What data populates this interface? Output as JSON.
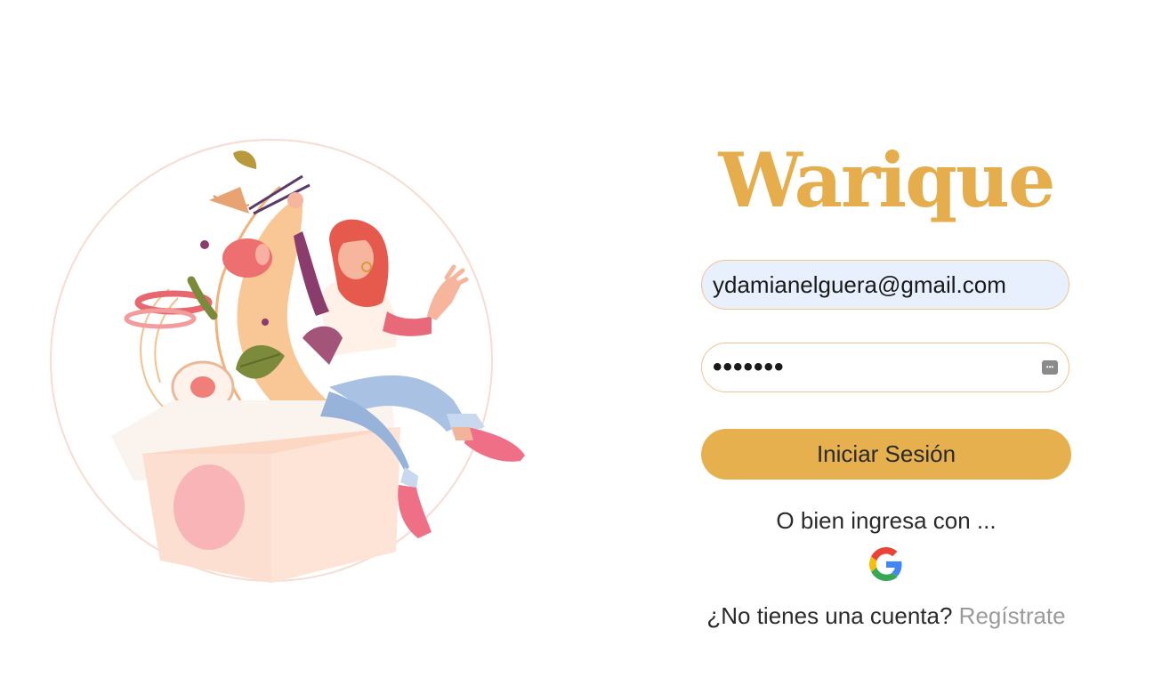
{
  "brand": {
    "name": "Warique",
    "color": "#e6ad4c"
  },
  "login": {
    "email_value": "ydamianelguera@gmail.com",
    "password_value": "•••••••",
    "submit_label": "Iniciar Sesión",
    "alt_login_text": "O bien ingresa con ...",
    "google_icon": "google-icon",
    "no_account_text": "¿No tienes una cuenta?",
    "register_label": "Regístrate"
  },
  "colors": {
    "field_border": "#f0c28f",
    "email_bg": "#e8effd",
    "button_bg": "#e6b04f",
    "link": "#9a9a9a"
  },
  "illustration": {
    "icon": "woman-with-noodle-box-illustration"
  }
}
